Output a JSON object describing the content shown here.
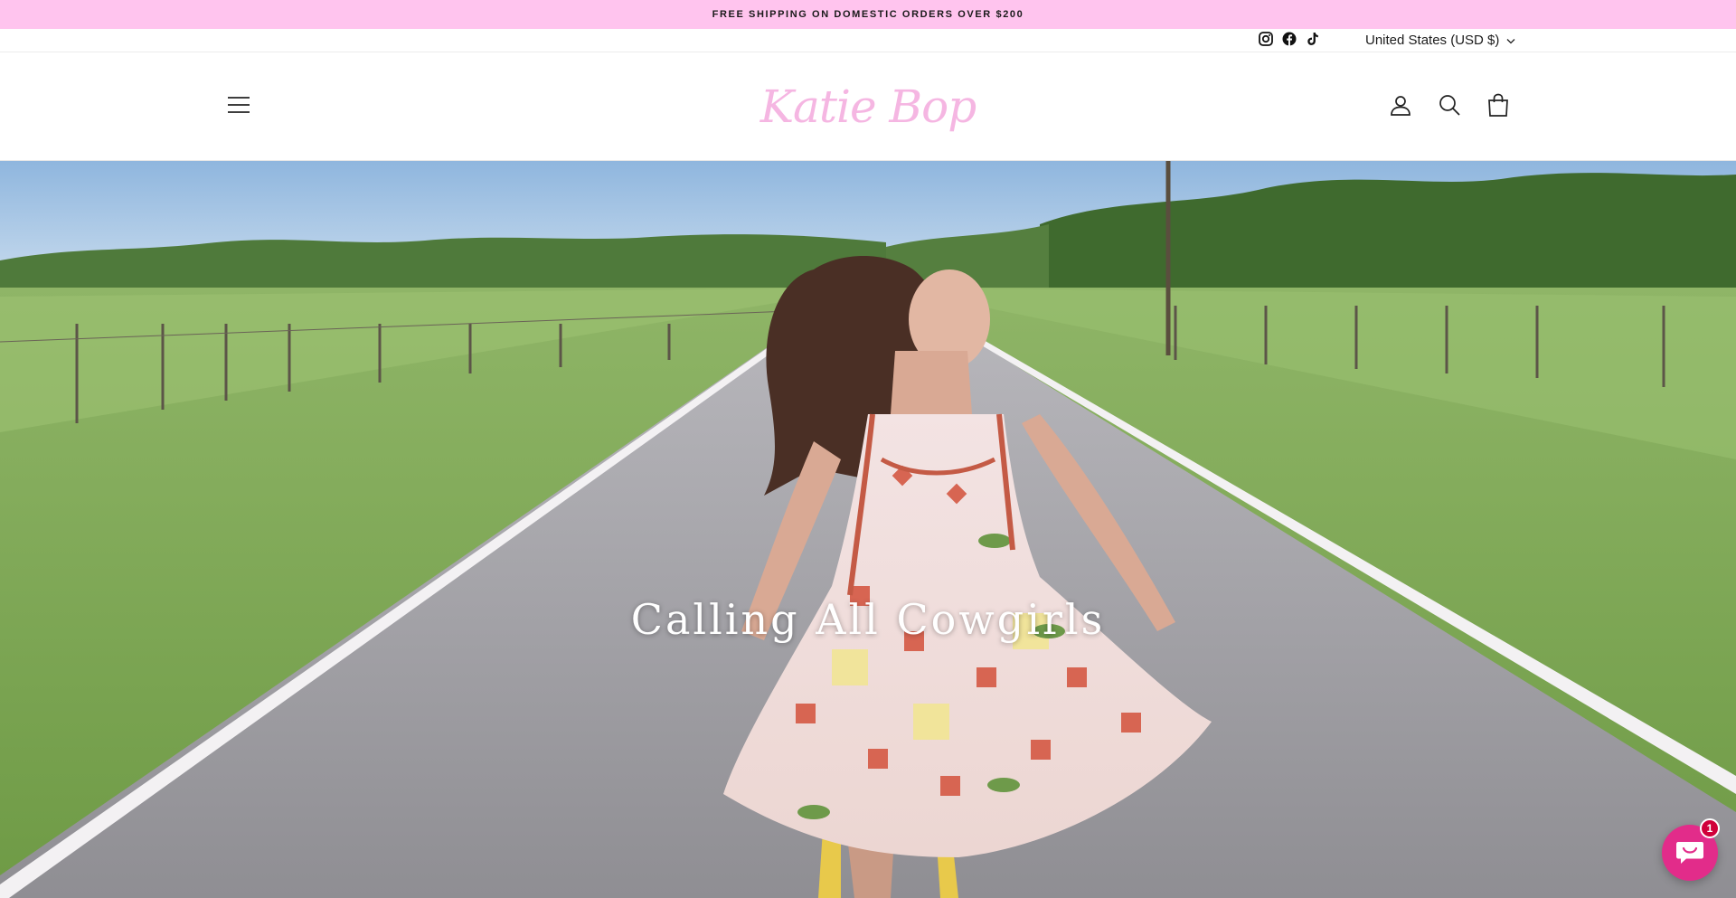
{
  "announcement": {
    "text": "FREE SHIPPING ON DOMESTIC ORDERS OVER $200"
  },
  "utility": {
    "social": [
      "instagram-icon",
      "facebook-icon",
      "tiktok-icon"
    ],
    "currency": "United States (USD $)"
  },
  "header": {
    "logo_text": "Katie Bop",
    "icons": [
      "account-icon",
      "search-icon",
      "cart-icon"
    ]
  },
  "hero": {
    "title": "Calling All Cowgirls"
  },
  "chat": {
    "badge_count": "1"
  },
  "colors": {
    "announcement_bg": "#ffc4ee",
    "logo": "#f5b6e2",
    "chat": "#e22c8a"
  }
}
